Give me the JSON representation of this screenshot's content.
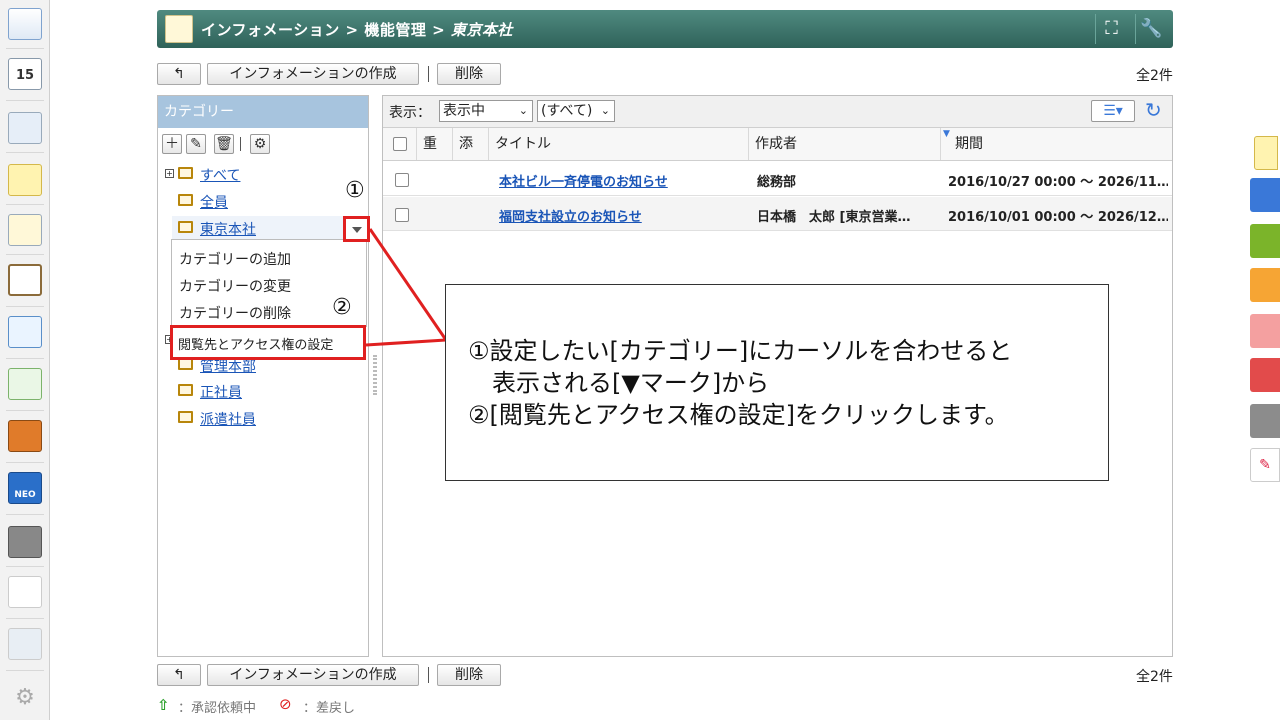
{
  "header": {
    "crumb_info": "インフォメーション",
    "crumb_sep1": ">",
    "crumb_func": "機能管理",
    "crumb_sep2": ">",
    "crumb_current": "東京本社"
  },
  "toolbar": {
    "back_label": "↰",
    "create_label": "インフォメーションの作成",
    "delete_label": "削除",
    "count": "全2件"
  },
  "sidebar": {
    "title": "カテゴリー",
    "tree": {
      "all": "すべて",
      "everyone": "全員",
      "tokyo": "東京本社",
      "kanri": "管理本部",
      "seishain": "正社員",
      "haken": "派遣社員"
    }
  },
  "menu": {
    "add": "カテゴリーの追加",
    "edit": "カテゴリーの変更",
    "remove": "カテゴリーの削除",
    "access": "閲覧先とアクセス権の設定"
  },
  "filter": {
    "label": "表示：",
    "select1": "表示中",
    "select2": "(すべて)"
  },
  "columns": {
    "dup": "重",
    "attach": "添",
    "title": "タイトル",
    "author": "作成者",
    "period": "期間"
  },
  "rows": [
    {
      "title": "本社ビル一斉停電のお知らせ",
      "author": "総務部",
      "period": "2016/10/27 00:00 ～ 2026/11…"
    },
    {
      "title": "福岡支社設立のお知らせ",
      "author": "日本橋　太郎 [東京営業…",
      "period": "2016/10/01 00:00 ～ 2026/12…"
    }
  ],
  "annotations": {
    "mark1": "①",
    "mark2": "②",
    "line1": "①設定したい[カテゴリー]にカーソルを合わせると",
    "line2": "表示される[▼マーク]から",
    "line3": "②[閲覧先とアクセス権の設定]をクリックします。"
  },
  "status": {
    "pending": "：承認依頼中",
    "rejected": "：差戻し"
  },
  "colors": {
    "header": "#3a7068",
    "category_head": "#a7c4de",
    "link": "#1a55b7",
    "highlight": "#e02020"
  }
}
